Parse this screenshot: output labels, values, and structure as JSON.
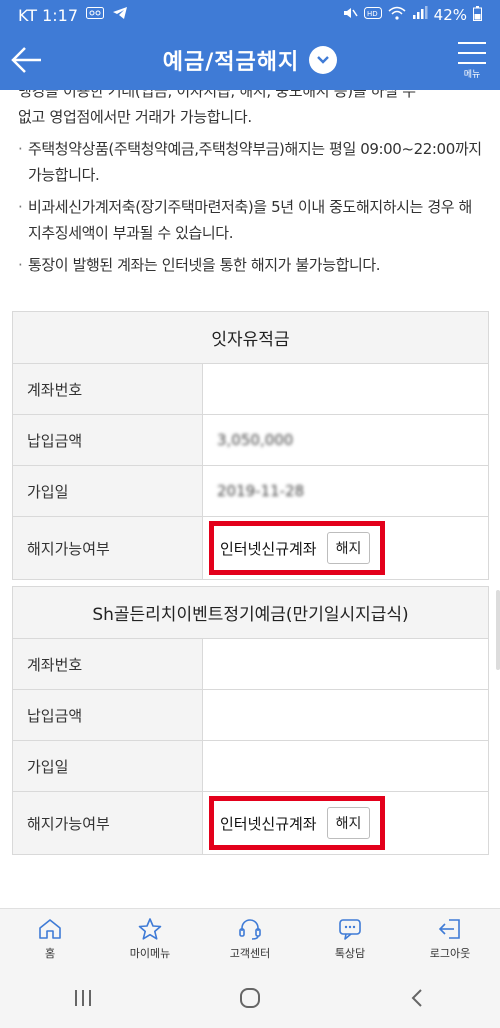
{
  "status": {
    "carrier_time": "KT 1:17",
    "battery": "42%"
  },
  "header": {
    "title": "예금/적금해지",
    "menu_label": "메뉴"
  },
  "notice": {
    "partial_line": "뱅킹을 이용한 거래(입금, 이자지급, 해지, 중도해지 등)를 하실 수",
    "lines": [
      "없고 영업점에서만 거래가 가능합니다.",
      "주택청약상품(주택청약예금,주택청약부금)해지는 평일 09:00~22:00까지 가능합니다.",
      "비과세신가계저축(장기주택마련저축)을 5년 이내 중도해지하시는 경우 해지추징세액이 부과될 수 있습니다.",
      "통장이 발행된 계좌는 인터넷을 통한 해지가 불가능합니다."
    ],
    "bullet": "·"
  },
  "accounts": [
    {
      "name": "잇자유적금",
      "labels": {
        "account_no": "계좌번호",
        "amount": "납입금액",
        "join_date": "가입일",
        "cancel_status": "해지가능여부"
      },
      "amount": "3,050,000",
      "join_date": "2019-11-28",
      "cancel_text": "인터넷신규계좌",
      "cancel_button": "해지"
    },
    {
      "name": "Sh골든리치이벤트정기예금(만기일시지급식)",
      "labels": {
        "account_no": "계좌번호",
        "amount": "납입금액",
        "join_date": "가입일",
        "cancel_status": "해지가능여부"
      },
      "amount": "",
      "join_date": "",
      "cancel_text": "인터넷신규계좌",
      "cancel_button": "해지"
    }
  ],
  "bottom_nav": [
    {
      "label": "홈",
      "icon": "home-icon"
    },
    {
      "label": "마이메뉴",
      "icon": "star-icon"
    },
    {
      "label": "고객센터",
      "icon": "headset-icon"
    },
    {
      "label": "톡상담",
      "icon": "chat-icon"
    },
    {
      "label": "로그아웃",
      "icon": "logout-icon"
    }
  ],
  "colors": {
    "header_blue": "#3f7bd6",
    "highlight_red": "#e3001b"
  }
}
